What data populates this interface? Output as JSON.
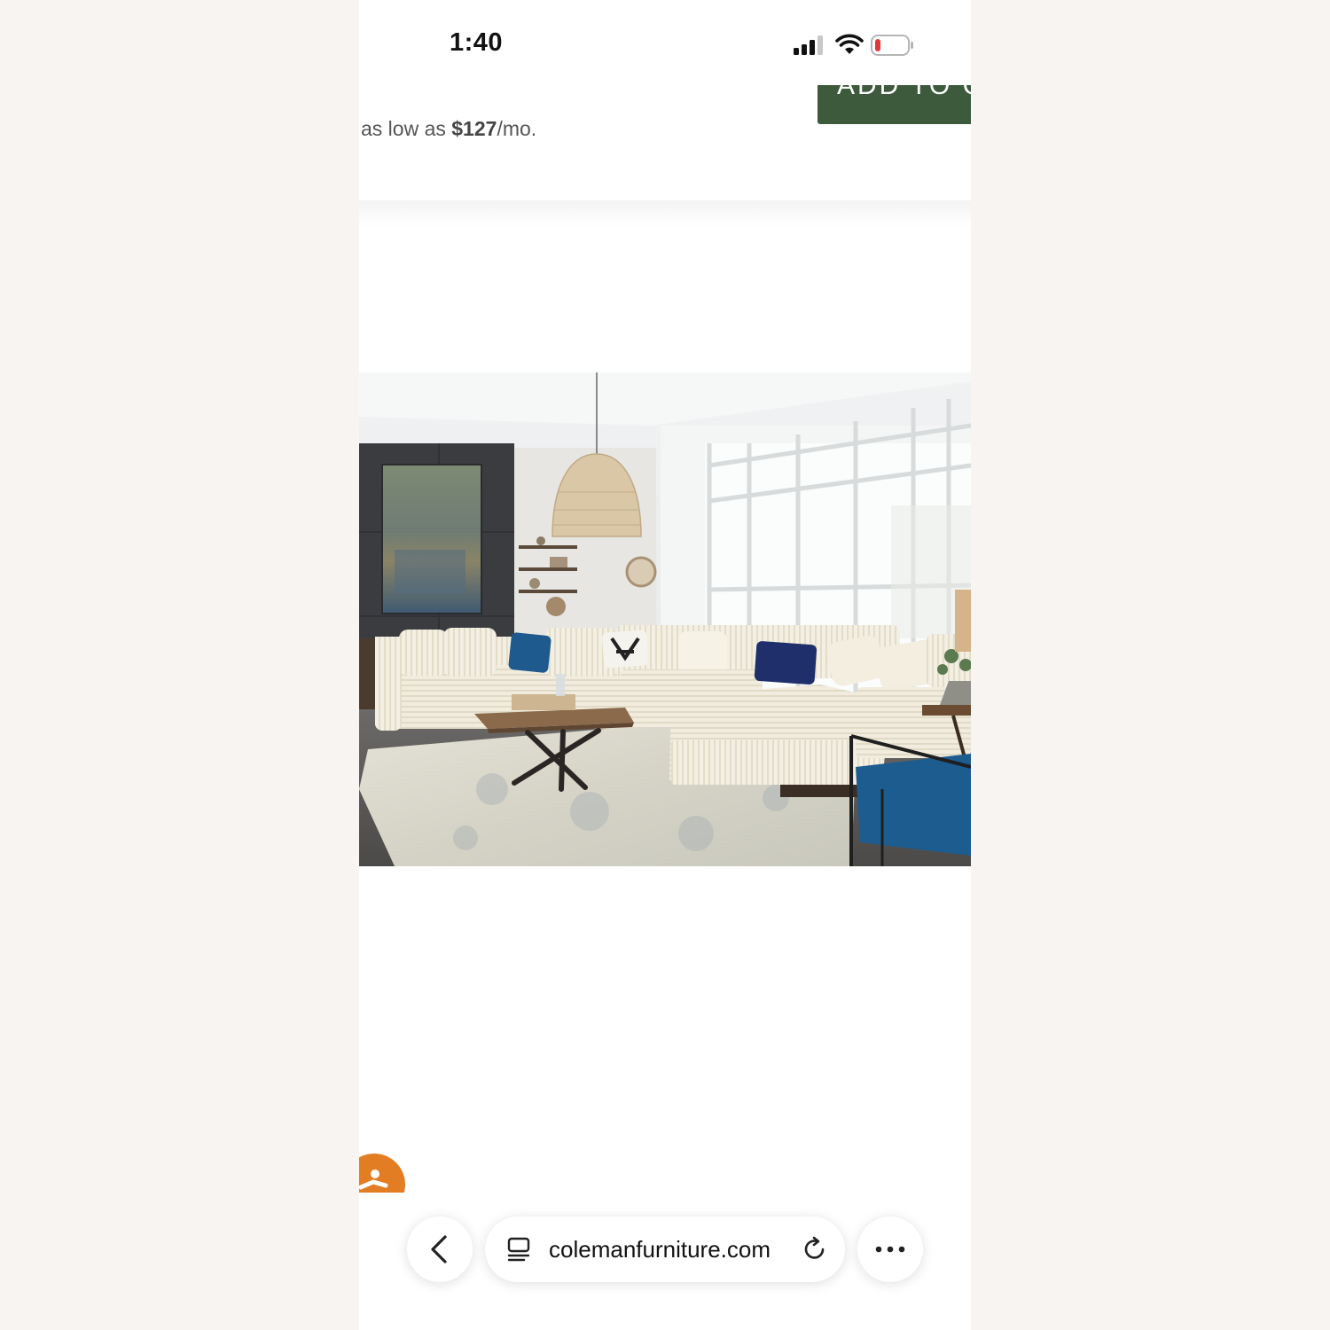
{
  "status_bar": {
    "time": "1:40",
    "icons": [
      "cellular-signal-icon",
      "wifi-icon",
      "battery-low-icon"
    ],
    "battery_color": "#e5373a"
  },
  "product": {
    "add_to_cart_label": "ADD TO CART",
    "finance_prefix": "as low as",
    "finance_amount": "$127",
    "finance_suffix": "/mo.",
    "button_color": "#3d5a3c"
  },
  "image": {
    "subject": "cream corduroy sectional sofa with chaise in bright living room"
  },
  "chat": {
    "icon": "chat-assistant-icon",
    "color": "#e37d24"
  },
  "browser": {
    "url": "colemanfurniture.com",
    "icons": [
      "chevron-left-icon",
      "tab-overview-icon",
      "reload-icon",
      "more-dots-icon"
    ]
  }
}
